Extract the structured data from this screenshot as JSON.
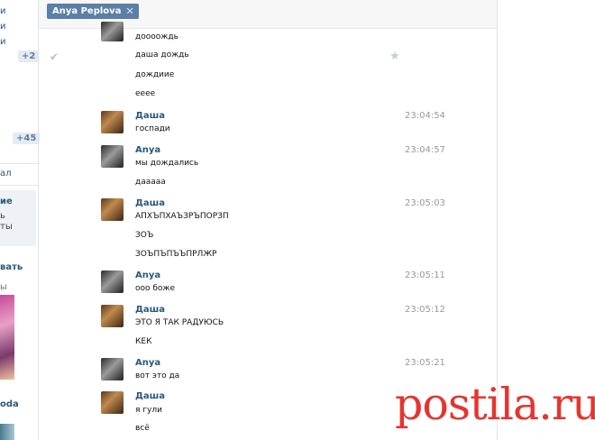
{
  "header": {
    "chip_label": "Anya Peplova",
    "chip_close": "✕"
  },
  "left": {
    "frag1": "и",
    "frag2": "и",
    "frag3": "и",
    "badge1": "+2",
    "badge2": "+45",
    "frag4": "ал",
    "frag5": "ие",
    "frag6": "ь",
    "frag7": "ты",
    "frag8": "вать",
    "frag9": "ы",
    "frag10": "oda"
  },
  "icons": {
    "check": "✔",
    "star": "★"
  },
  "messages": [
    {
      "sender": "",
      "time": "",
      "lines": [
        "доооождь",
        "даша дождь",
        "дождиие",
        "ееее"
      ]
    },
    {
      "sender": "Даша",
      "time": "23:04:54",
      "lines": [
        "госпади"
      ]
    },
    {
      "sender": "Anya",
      "time": "23:04:57",
      "lines": [
        "мы дождались",
        "дааааа"
      ]
    },
    {
      "sender": "Даша",
      "time": "23:05:03",
      "lines": [
        "АПХЪПХАЪЗРЪПОРЗП",
        "ЗОЪ",
        "ЗОЪПЪПЪЪПРЛЖР"
      ]
    },
    {
      "sender": "Anya",
      "time": "23:05:11",
      "lines": [
        "ооо боже"
      ]
    },
    {
      "sender": "Даша",
      "time": "23:05:12",
      "lines": [
        "ЭТО Я ТАК РАДУЮСЬ",
        "КЕК"
      ]
    },
    {
      "sender": "Anya",
      "time": "23:05:21",
      "lines": [
        "вот это да"
      ]
    },
    {
      "sender": "Даша",
      "time": "",
      "lines": [
        "я гули",
        "всё"
      ]
    }
  ],
  "watermark": {
    "text": "postila",
    "dot": ".",
    "tld": "ru"
  }
}
